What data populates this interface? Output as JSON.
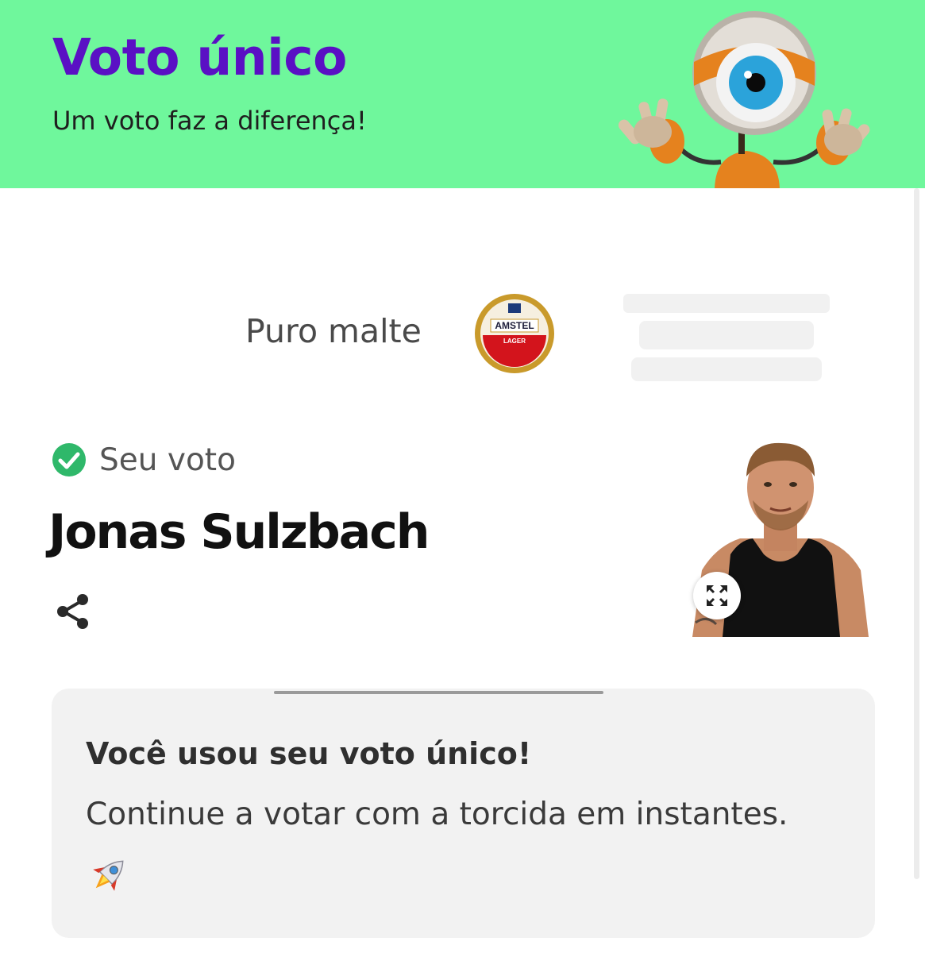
{
  "header": {
    "title": "Voto único",
    "subtitle": "Um voto faz a diferença!",
    "mascot_icon": "big-brother-eye-mascot",
    "background_color": "#6ff79c",
    "title_color": "#5a10c4"
  },
  "sponsor": {
    "tagline": "Puro malte",
    "logo_text": "AMSTEL",
    "logo_subtext": "LAGER",
    "logo_icon": "amstel-logo"
  },
  "vote": {
    "status_icon": "check-circle-icon",
    "label": "Seu voto",
    "candidate": "Jonas Sulzbach",
    "share_icon": "share-icon",
    "expand_icon": "expand-icon",
    "check_color": "#2fb86a"
  },
  "info_card": {
    "title": "Você usou seu voto único!",
    "message": "Continue a votar com a torcida em instantes.",
    "emoji_icon": "rocket-icon"
  }
}
